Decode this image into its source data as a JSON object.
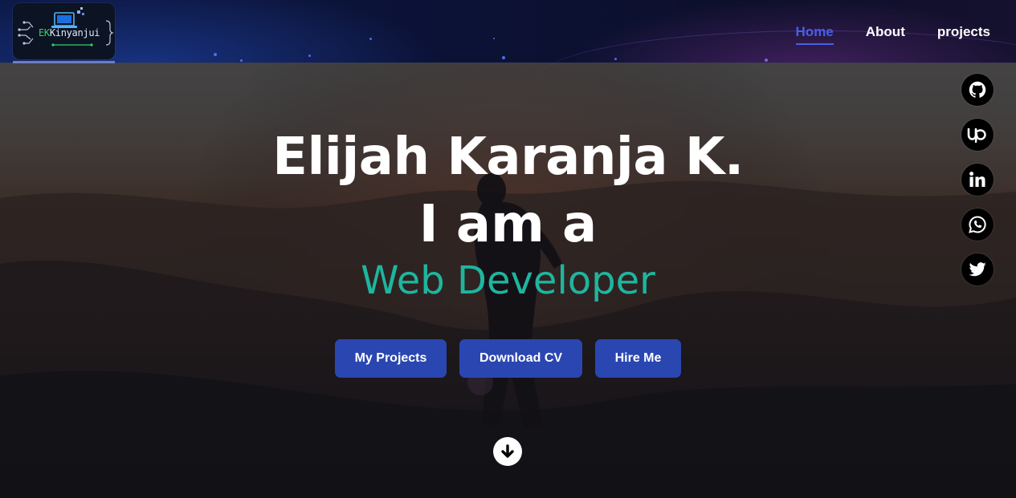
{
  "logo": {
    "prefix": "EK",
    "name": "Kinyanjui"
  },
  "nav": {
    "links": [
      {
        "label": "Home",
        "active": true
      },
      {
        "label": "About",
        "active": false
      },
      {
        "label": "projects",
        "active": false
      }
    ]
  },
  "hero": {
    "name": "Elijah Karanja K.",
    "intro": "I am a",
    "role": "Web Developer",
    "buttons": {
      "projects": "My Projects",
      "cv": "Download CV",
      "hire": "Hire Me"
    }
  },
  "socials": [
    {
      "icon": "github-icon"
    },
    {
      "icon": "upwork-icon"
    },
    {
      "icon": "linkedin-icon"
    },
    {
      "icon": "whatsapp-icon"
    },
    {
      "icon": "twitter-icon"
    }
  ],
  "colors": {
    "accent": "#4a5ee8",
    "role": "#1fb59e",
    "button": "#2a46b0"
  }
}
